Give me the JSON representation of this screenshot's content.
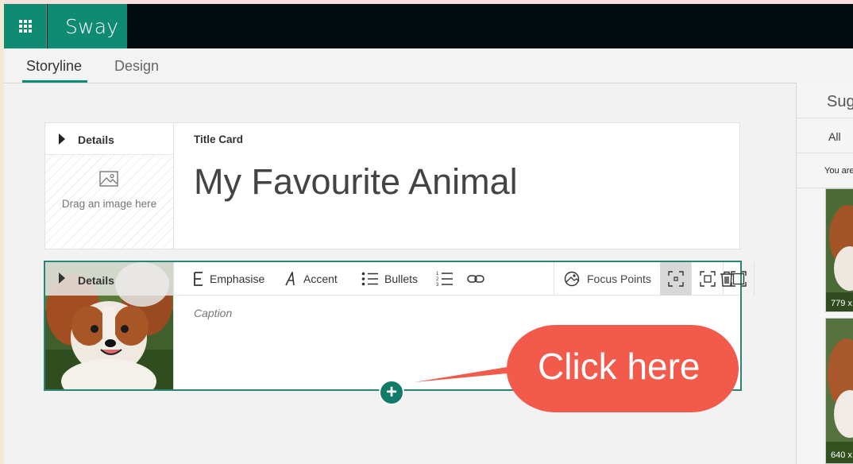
{
  "app": {
    "name": "Sway",
    "launcher_icon": "app-launcher-icon"
  },
  "tabs": [
    {
      "label": "Storyline",
      "active": true
    },
    {
      "label": "Design",
      "active": false
    }
  ],
  "title_card": {
    "details_label": "Details",
    "drag_hint": "Drag an image here",
    "card_type": "Title Card",
    "title": "My Favourite Animal"
  },
  "image_card": {
    "details_label": "Details",
    "toolbar": {
      "emphasise": "Emphasise",
      "accent": "Accent",
      "bullets": "Bullets",
      "focus_points": "Focus Points"
    },
    "caption_placeholder": "Caption"
  },
  "add_button_symbol": "+",
  "callout": {
    "text": "Click here",
    "color": "#f25a4c"
  },
  "suggestions_panel": {
    "title": "Sug",
    "filter": "All",
    "note": "You are",
    "thumbnails": [
      {
        "size": "779 x"
      },
      {
        "size": "640 x"
      }
    ]
  },
  "colors": {
    "accent": "#0f8a73",
    "appbar": "#020c0f",
    "card_border": "#2b8575"
  }
}
